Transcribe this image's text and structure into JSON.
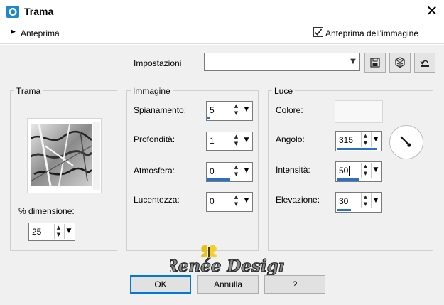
{
  "window": {
    "title": "Trama",
    "close_glyph": "✕",
    "icon": "app-icon"
  },
  "topbar": {
    "expand_glyph": "▶",
    "preview_label": "Anteprima",
    "preview_image_checkbox": {
      "label": "Anteprima dell'immagine",
      "checked": true
    }
  },
  "settings": {
    "label": "Impostazioni",
    "value": "",
    "buttons": [
      "save-preset-icon",
      "randomize-dice-icon",
      "reset-icon"
    ]
  },
  "groups": {
    "trama": {
      "title": "Trama",
      "size_label": "% dimensione:",
      "size_value": "25"
    },
    "immagine": {
      "title": "Immagine",
      "fields": [
        {
          "label": "Spianamento:",
          "value": "5"
        },
        {
          "label": "Profondità:",
          "value": "1"
        },
        {
          "label": "Atmosfera:",
          "value": "0"
        },
        {
          "label": "Lucentezza:",
          "value": "0"
        }
      ]
    },
    "luce": {
      "title": "Luce",
      "color_label": "Colore:",
      "color": "#f8f8f8",
      "fields": [
        {
          "label": "Angolo:",
          "value": "315"
        },
        {
          "label": "Intensità:",
          "value": "50"
        },
        {
          "label": "Elevazione:",
          "value": "30"
        }
      ]
    }
  },
  "watermark": "Renée Design",
  "buttons": {
    "ok": "OK",
    "cancel": "Annulla",
    "help": "?"
  },
  "spin_glyphs": {
    "up": "▲",
    "down": "▼",
    "dropdown": "▼"
  },
  "colors": {
    "accent": "#0078d7",
    "value_bar": "#2d6fc4",
    "dialog_bg": "#f0f0f0"
  }
}
